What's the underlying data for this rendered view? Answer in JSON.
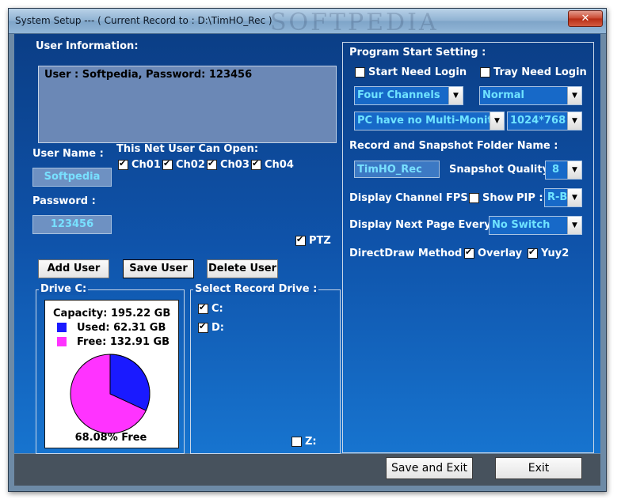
{
  "window": {
    "title": "System Setup --- ( Current Record to : D:\\TimHO_Rec )",
    "watermark": "SOFTPEDIA",
    "close_glyph": "✕"
  },
  "user_info": {
    "heading": "User Information:",
    "content": "User : Softpedia, Password: 123456",
    "user_name_label": "User Name :",
    "user_name_value": "Softpedia",
    "password_label": "Password :",
    "password_value": "123456",
    "net_user_heading": "This Net User Can Open:",
    "channels": [
      {
        "label": "Ch01",
        "checked": true
      },
      {
        "label": "Ch02",
        "checked": true
      },
      {
        "label": "Ch03",
        "checked": true
      },
      {
        "label": "Ch04",
        "checked": true
      }
    ],
    "ptz_label": "PTZ",
    "ptz_checked": true,
    "buttons": {
      "add": "Add User",
      "save": "Save User",
      "delete": "Delete User"
    }
  },
  "drive": {
    "group_label": "Drive C:",
    "capacity": "Capacity: 195.22 GB",
    "used": "Used: 62.31 GB",
    "free": "Free: 132.91 GB",
    "free_percent_label": "68.08% Free",
    "free_fraction": 0.6808,
    "used_color": "#1a1aff",
    "free_color": "#ff33ff"
  },
  "record_drive": {
    "group_label": "Select Record Drive :",
    "drives": [
      {
        "label": "C:",
        "checked": true
      },
      {
        "label": "D:",
        "checked": true
      },
      {
        "label": "Z:",
        "checked": false
      }
    ]
  },
  "program": {
    "heading": "Program Start Setting :",
    "start_need_login": "Start Need Login",
    "tray_need_login": "Tray Need Login",
    "channels_combo": "Four Channels",
    "mode_combo": "Normal",
    "pc_combo": "PC have no Multi-Monitor",
    "resolution_combo": "1024*768",
    "folder_heading": "Record and Snapshot Folder Name :",
    "folder_value": "TimHO_Rec",
    "snapshot_quality_label": "Snapshot Quality :",
    "snapshot_quality_value": "8",
    "fps_label": "Display Channel FPS :",
    "fps_show": "Show",
    "pip_label": "PIP :",
    "pip_value": "R-B",
    "next_page_label": "Display Next Page Every :",
    "next_page_value": "No Switch",
    "directdraw_label": "DirectDraw Method :",
    "overlay_label": "Overlay",
    "overlay_checked": true,
    "yuy2_label": "Yuy2",
    "yuy2_checked": true
  },
  "footer": {
    "save_exit": "Save and Exit",
    "exit": "Exit"
  }
}
